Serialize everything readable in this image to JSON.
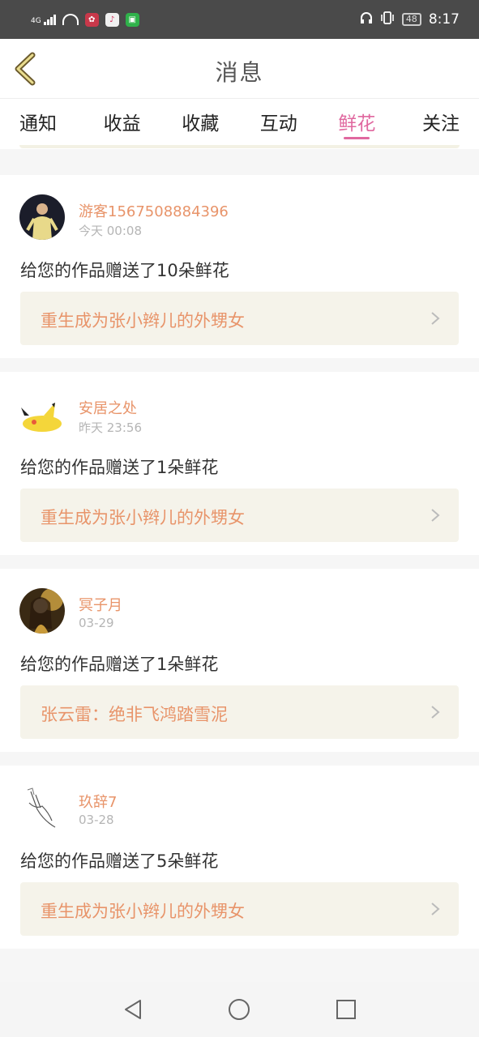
{
  "status_bar": {
    "network": "4G",
    "app_icons": [
      "huawei-icon",
      "music-app-icon",
      "wechat-icon"
    ],
    "battery": "48",
    "time": "8:17"
  },
  "header": {
    "title": "消息"
  },
  "tabs": [
    {
      "label": "通知",
      "active": false
    },
    {
      "label": "收益",
      "active": false
    },
    {
      "label": "收藏",
      "active": false
    },
    {
      "label": "互动",
      "active": false
    },
    {
      "label": "鲜花",
      "active": true
    },
    {
      "label": "关注",
      "active": false
    }
  ],
  "messages": [
    {
      "user": "游客1567508884396",
      "time": "今天 00:08",
      "text": "给您的作品赠送了10朵鲜花",
      "work": "重生成为张小辫儿的外甥女"
    },
    {
      "user": "安居之处",
      "time": "昨天 23:56",
      "text": "给您的作品赠送了1朵鲜花",
      "work": "重生成为张小辫儿的外甥女"
    },
    {
      "user": "冥子月",
      "time": "03-29",
      "text": "给您的作品赠送了1朵鲜花",
      "work": "张云雷：绝非飞鸿踏雪泥"
    },
    {
      "user": "玖辞7",
      "time": "03-28",
      "text": "给您的作品赠送了5朵鲜花",
      "work": "重生成为张小辫儿的外甥女"
    }
  ],
  "colors": {
    "accent_pink": "#e0689f",
    "link_orange": "#e8946a",
    "link_bg": "#f5f3ea"
  }
}
